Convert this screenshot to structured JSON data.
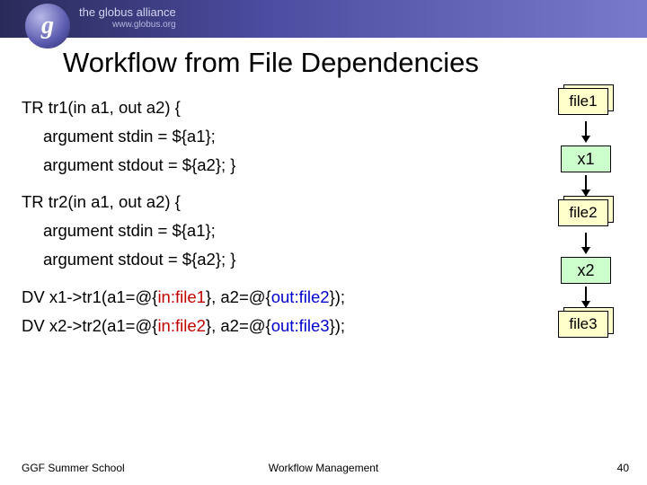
{
  "header": {
    "logo_letter": "g",
    "text": "the globus alliance",
    "url": "www.globus.org"
  },
  "title": "Workflow from File Dependencies",
  "code": {
    "l1": "TR tr1(in a1, out a2) {",
    "l2": "argument stdin = ${a1};",
    "l3": "argument stdout = ${a2}; }",
    "l4": "TR tr2(in a1, out a2) {",
    "l5": "argument stdin = ${a1};",
    "l6": "argument stdout = ${a2}; }",
    "dv1_pre": "DV x1->tr1(a1=@{",
    "dv1_in": "in:file1",
    "dv1_mid": "}, a2=@{",
    "dv1_out": "out:file2",
    "dv1_end": "});",
    "dv2_pre": "DV x2->tr2(a1=@{",
    "dv2_in": "in:file2",
    "dv2_mid": "}, a2=@{",
    "dv2_out": "out:file3",
    "dv2_end": "});"
  },
  "diagram": {
    "file1": "file1",
    "x1": "x1",
    "file2": "file2",
    "x2": "x2",
    "file3": "file3"
  },
  "footer": {
    "left": "GGF Summer School",
    "center": "Workflow Management",
    "page": "40"
  }
}
